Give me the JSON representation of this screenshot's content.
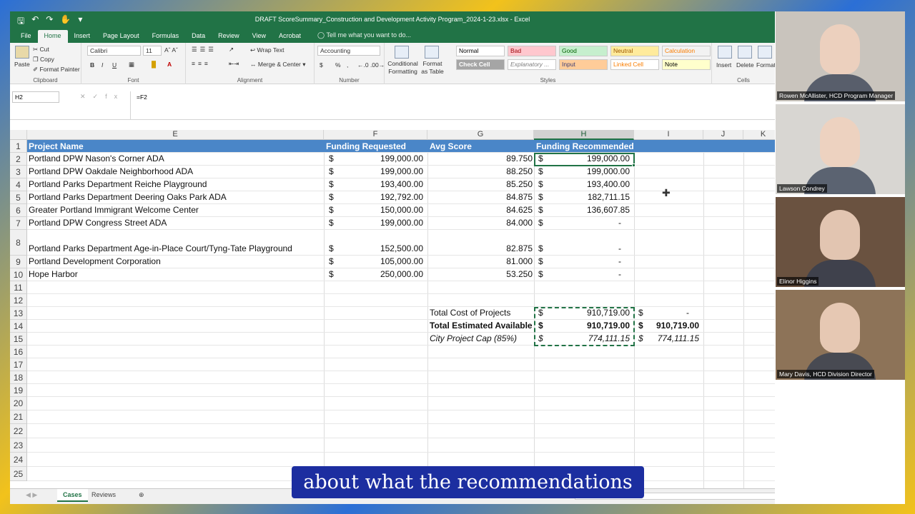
{
  "window": {
    "title": "DRAFT ScoreSummary_Construction and Development Activity Program_2024-1-23.xlsx - Excel"
  },
  "ribbon": {
    "tabs": [
      "File",
      "Home",
      "Insert",
      "Page Layout",
      "Formulas",
      "Data",
      "Review",
      "View",
      "Acrobat"
    ],
    "active_tab": "Home",
    "tell_me": "Tell me what you want to do...",
    "clipboard": {
      "paste": "Paste",
      "cut": "Cut",
      "copy": "Copy",
      "format_painter": "Format Painter",
      "label": "Clipboard"
    },
    "font": {
      "name": "Calibri",
      "size": "11",
      "label": "Font",
      "bold": "B",
      "italic": "I",
      "underline": "U"
    },
    "alignment": {
      "wrap_text": "Wrap Text",
      "merge_center": "Merge & Center",
      "label": "Alignment"
    },
    "number": {
      "format": "Accounting",
      "currency": "$",
      "percent": "%",
      "comma": ",",
      "label": "Number"
    },
    "styles": {
      "conditional": "Conditional Formatting",
      "format_as_table": "Format as Table",
      "cells": [
        {
          "label": "Normal",
          "bg": "#ffffff",
          "color": "#000000"
        },
        {
          "label": "Bad",
          "bg": "#ffc7ce",
          "color": "#9c0006"
        },
        {
          "label": "Good",
          "bg": "#c6efce",
          "color": "#006100"
        },
        {
          "label": "Neutral",
          "bg": "#ffeb9c",
          "color": "#9c5700"
        },
        {
          "label": "Calculation",
          "bg": "#f2f2f2",
          "color": "#fa7d00"
        },
        {
          "label": "Check Cell",
          "bg": "#a5a5a5",
          "color": "#ffffff"
        },
        {
          "label": "Explanatory ...",
          "bg": "#ffffff",
          "color": "#7f7f7f"
        },
        {
          "label": "Input",
          "bg": "#ffcc99",
          "color": "#3f3f76"
        },
        {
          "label": "Linked Cell",
          "bg": "#ffffff",
          "color": "#fa7d00"
        },
        {
          "label": "Note",
          "bg": "#ffffcc",
          "color": "#000000"
        }
      ],
      "label": "Styles"
    },
    "cells_group": {
      "insert": "Insert",
      "delete": "Delete",
      "format": "Format",
      "label": "Cells"
    }
  },
  "formula_bar": {
    "name_box": "H2",
    "formula": "=F2"
  },
  "columns": [
    "E",
    "F",
    "G",
    "H",
    "I",
    "J",
    "K"
  ],
  "selected_column": "H",
  "rows": [
    "1",
    "2",
    "3",
    "4",
    "5",
    "6",
    "7",
    "8",
    "9",
    "10",
    "11",
    "12",
    "13",
    "14",
    "15",
    "16",
    "17",
    "18",
    "19",
    "20",
    "21",
    "22",
    "23",
    "24",
    "25"
  ],
  "table": {
    "headers": {
      "project": "Project Name",
      "funding": "Funding Requested",
      "score": "Avg Score",
      "recommended": "Funding Recommended"
    },
    "items": [
      {
        "project": "Portland DPW Nason's Corner ADA",
        "cur": "$",
        "funding": "199,000.00",
        "score": "89.750",
        "rcur": "$",
        "recommended": "199,000.00"
      },
      {
        "project": "Portland DPW Oakdale Neighborhood ADA",
        "cur": "$",
        "funding": "199,000.00",
        "score": "88.250",
        "rcur": "$",
        "recommended": "199,000.00"
      },
      {
        "project": "Portland Parks Department Reiche Playground",
        "cur": "$",
        "funding": "193,400.00",
        "score": "85.250",
        "rcur": "$",
        "recommended": "193,400.00"
      },
      {
        "project": "Portland Parks Department Deering Oaks Park ADA",
        "cur": "$",
        "funding": "192,792.00",
        "score": "84.875",
        "rcur": "$",
        "recommended": "182,711.15"
      },
      {
        "project": "Greater Portland Immigrant Welcome Center",
        "cur": "$",
        "funding": "150,000.00",
        "score": "84.625",
        "rcur": "$",
        "recommended": "136,607.85"
      },
      {
        "project": "Portland DPW Congress Street ADA",
        "cur": "$",
        "funding": "199,000.00",
        "score": "84.000",
        "rcur": "$",
        "recommended": "-"
      },
      {
        "project": "Portland Parks Department Age-in-Place Court/Tyng-Tate Playground",
        "cur": "$",
        "funding": "152,500.00",
        "score": "82.875",
        "rcur": "$",
        "recommended": "-"
      },
      {
        "project": "Portland Development Corporation",
        "cur": "$",
        "funding": "105,000.00",
        "score": "81.000",
        "rcur": "$",
        "recommended": "-"
      },
      {
        "project": "Hope Harbor",
        "cur": "$",
        "funding": "250,000.00",
        "score": "53.250",
        "rcur": "$",
        "recommended": "-"
      }
    ]
  },
  "totals": [
    {
      "label": "Total Cost of Projects",
      "cur": "$",
      "h": "910,719.00",
      "icur": "$",
      "i": "-"
    },
    {
      "label": "Total Estimated Available",
      "cur": "$",
      "h": "910,719.00",
      "icur": "$",
      "i": "910,719.00"
    },
    {
      "label": "City Project Cap (85%)",
      "cur": "$",
      "h": "774,111.15",
      "icur": "$",
      "i": "774,111.15"
    }
  ],
  "sheets": [
    "Cases",
    "Reviews"
  ],
  "active_sheet": "Cases",
  "participants": [
    {
      "name": "Rowen McAllister, HCD Program  Manager",
      "bg": "#c9c4bd"
    },
    {
      "name": "Lawson Condrey",
      "bg": "#d8d6d2"
    },
    {
      "name": "Elinor Higgins",
      "bg": "#6a5240"
    },
    {
      "name": "Mary Davis, HCD Division Director",
      "bg": "#8d7358"
    }
  ],
  "caption": "about what the recommendations"
}
